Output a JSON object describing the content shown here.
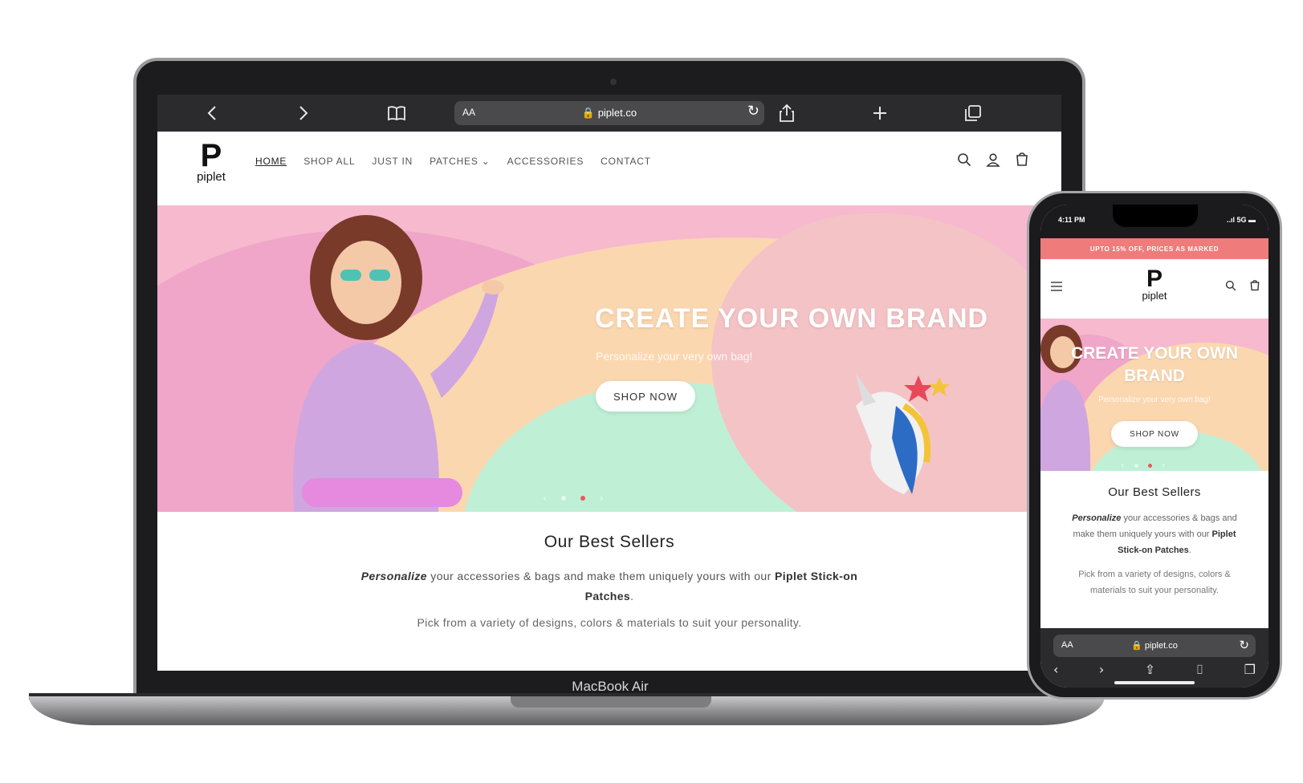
{
  "laptop": {
    "device_label": "MacBook Air",
    "browser": {
      "aa_label": "AA",
      "url": "🔒 piplet.co",
      "icons": [
        "chevron-left-icon",
        "chevron-right-icon",
        "book-icon",
        "reload-icon",
        "share-icon",
        "plus-icon",
        "tabs-icon"
      ]
    },
    "site": {
      "logo_mark": "P",
      "logo_text": "piplet",
      "nav": [
        "HOME",
        "SHOP ALL",
        "JUST IN",
        "PATCHES",
        "ACCESSORIES",
        "CONTACT"
      ],
      "nav_dropdown_icon": "⌄",
      "header_icons": [
        "search-icon",
        "account-icon",
        "cart-icon"
      ],
      "hero": {
        "title": "CREATE YOUR OWN BRAND",
        "subtitle": "Personalize your very own bag!",
        "button": "SHOP NOW",
        "slide_count": 2,
        "active_slide": 2
      },
      "best_sellers": {
        "title": "Our Best Sellers",
        "p1_em": "Personalize",
        "p1_mid": " your accessories & bags and make them uniquely yours with our ",
        "p1_bold": "Piplet Stick-on Patches",
        "p1_end": ".",
        "p2": "Pick from a variety of designs, colors & materials to suit your personality."
      }
    }
  },
  "phone": {
    "status_time": "4:11 PM",
    "status_network": "..ıl 5G ▬",
    "promo_banner": "UPTO 15% OFF, PRICES AS MARKED",
    "browser": {
      "aa_label": "AA",
      "url": "🔒 piplet.co"
    },
    "site": {
      "logo_mark": "P",
      "logo_text": "piplet",
      "hero": {
        "title": "CREATE YOUR OWN BRAND",
        "subtitle": "Personalize your very own bag!",
        "button": "SHOP NOW"
      },
      "best_sellers": {
        "title": "Our Best Sellers",
        "p1_em": "Personalize",
        "p1_mid": " your accessories & bags and make them uniquely yours with our ",
        "p1_bold": "Piplet Stick-on Patches",
        "p1_end": ".",
        "p2": "Pick from a variety of designs, colors & materials to suit your personality."
      }
    }
  },
  "colors": {
    "hero_pink": "#f6b9ce",
    "hero_peach": "#fbd7b0",
    "hero_mint": "#bff0d6",
    "hero_lilac": "#f0a6c8",
    "promo": "#ef7b7b",
    "dot_active": "#e85a5a",
    "browser_chrome": "#2b2b2d"
  }
}
